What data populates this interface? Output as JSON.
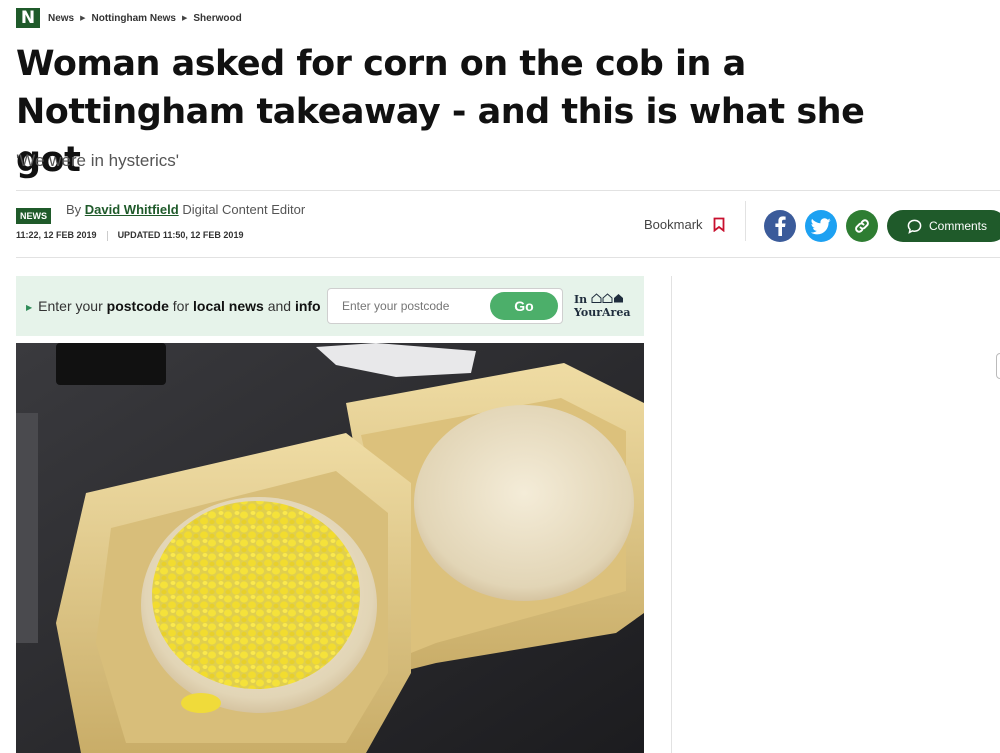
{
  "breadcrumb": {
    "logo": "N",
    "items": [
      "News",
      "Nottingham News",
      "Sherwood"
    ]
  },
  "article": {
    "headline": "Woman asked for corn on the cob in a Nottingham takeaway - and this is what she got",
    "standfirst": "'We were in hysterics'"
  },
  "meta": {
    "badge": "NEWS",
    "by": "By",
    "author": "David Whitfield",
    "role": "Digital Content Editor",
    "published": "11:22, 12 FEB 2019",
    "updated": "UPDATED 11:50, 12 FEB 2019"
  },
  "actions": {
    "bookmark": "Bookmark",
    "comments": "Comments",
    "icons": [
      "facebook-icon",
      "twitter-icon",
      "link-icon",
      "comment-bubble-icon",
      "bookmark-icon"
    ]
  },
  "promo": {
    "t1": "Enter your ",
    "b1": "postcode",
    "t2": " for ",
    "b2": "local news",
    "t3": " and ",
    "b3": "info",
    "placeholder": "Enter your postcode",
    "go": "Go",
    "brand1": "In",
    "brand2": "YourArea"
  },
  "colors": {
    "brand_green": "#1f5a2a",
    "go_green": "#4caf6a",
    "promo_bg": "#e6f3ea",
    "facebook": "#3b5b9a",
    "twitter": "#1da1f2",
    "bookmark_red": "#c8102e"
  }
}
